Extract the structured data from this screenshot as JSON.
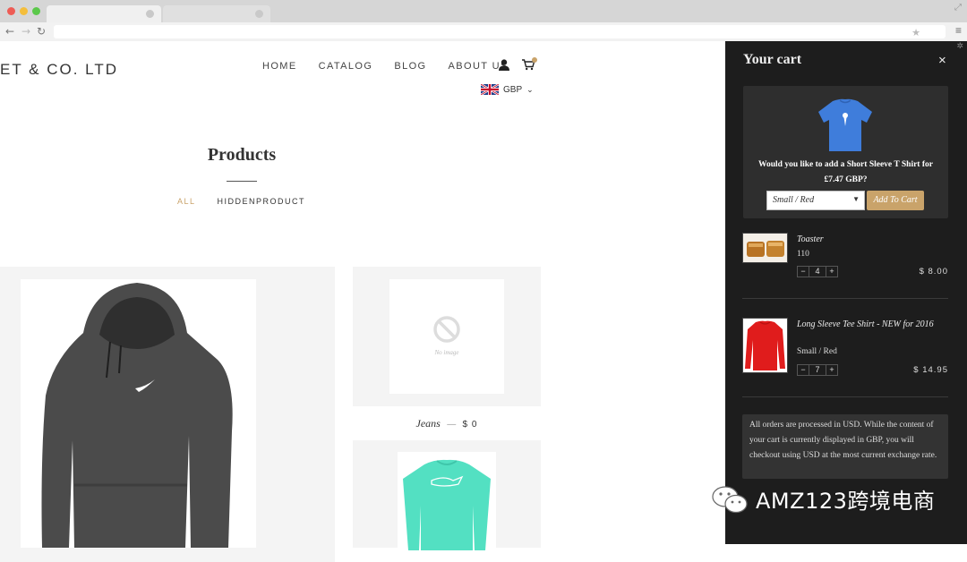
{
  "store": {
    "logo": "ET & CO. LTD",
    "nav": [
      "HOME",
      "CATALOG",
      "BLOG",
      "ABOUT US"
    ],
    "currency": "GBP",
    "page_title": "Products",
    "filters": [
      {
        "label": "ALL",
        "active": true
      },
      {
        "label": "HIDDENPRODUCT",
        "active": false
      }
    ],
    "products": [
      {
        "name": "Jeans",
        "sep": "—",
        "price": "$ 0",
        "image_placeholder": "No image"
      }
    ]
  },
  "cart": {
    "title": "Your cart",
    "close": "×",
    "upsell": {
      "text": "Would you like to add a Short Sleeve T Shirt for £7.47 GBP?",
      "variant": "Small / Red",
      "button": "Add To Cart"
    },
    "items": [
      {
        "name": "Toaster",
        "variant": "110",
        "qty": "4",
        "price": "$ 8.00",
        "minus": "−",
        "plus": "+"
      },
      {
        "name": "Long Sleeve Tee Shirt - NEW for 2016",
        "variant": "Small / Red",
        "qty": "7",
        "price": "$ 14.95",
        "minus": "−",
        "plus": "+"
      }
    ],
    "notice": "All orders are processed in USD. While the content of your cart is currently displayed in GBP, you will checkout using USD at the most current exchange rate."
  },
  "watermark": "AMZ123跨境电商",
  "colors": {
    "accent": "#c9a36a",
    "drawer_bg": "#1d1d1d",
    "card_bg": "#f4f4f4"
  }
}
